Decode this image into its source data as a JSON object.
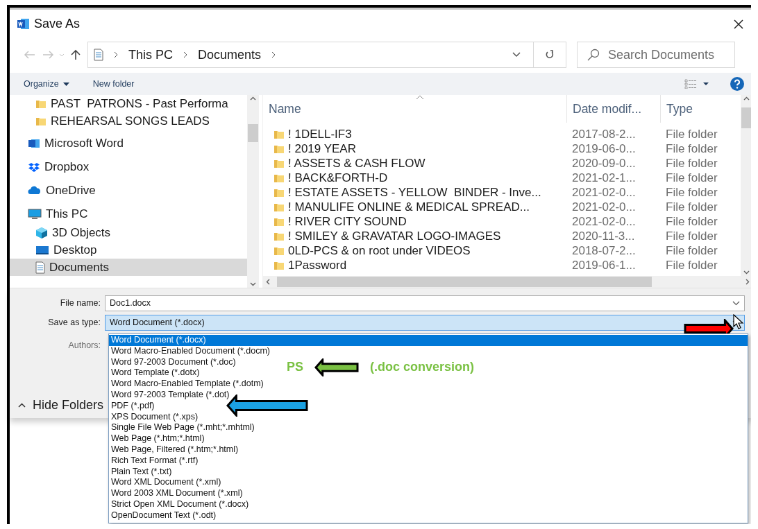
{
  "window": {
    "title": "Save As"
  },
  "address_bar": {
    "crumbs": [
      "This PC",
      "Documents"
    ]
  },
  "search": {
    "placeholder": "Search Documents"
  },
  "toolbar": {
    "buttons": [
      "Organize",
      "New folder"
    ]
  },
  "sidebar": {
    "items": [
      {
        "children": [
          {
            "label": "PAST  PATRONS - Past Performa",
            "kind": "folder",
            "selected": false
          },
          {
            "label": "REHEARSAL SONGS LEADS",
            "kind": "folder",
            "selected": false
          }
        ]
      },
      {
        "label": "Microsoft Word",
        "kind": "word",
        "selected": false
      },
      {
        "label": "Dropbox",
        "kind": "dropbox",
        "selected": false
      },
      {
        "label": "OneDrive",
        "kind": "onedrive",
        "selected": false
      },
      {
        "label": "This PC",
        "kind": "pc",
        "selected": false,
        "children": [
          {
            "label": "3D Objects",
            "kind": "objects",
            "selected": false
          },
          {
            "label": "Desktop",
            "kind": "desktop",
            "selected": false
          },
          {
            "label": "Documents",
            "kind": "documents",
            "selected": true
          }
        ]
      }
    ]
  },
  "file_list": {
    "columns": [
      "Name",
      "Date modif...",
      "Type"
    ],
    "rows": [
      {
        "name": "! 1DELL-IF3",
        "date": "2017-08-2...",
        "type": "File folder"
      },
      {
        "name": "! 2019 YEAR",
        "date": "2019-06-0...",
        "type": "File folder"
      },
      {
        "name": "! ASSETS & CASH FLOW",
        "date": "2020-09-0...",
        "type": "File folder"
      },
      {
        "name": "! BACK&FORTH-D",
        "date": "2021-02-1...",
        "type": "File folder"
      },
      {
        "name": "! ESTATE ASSETS - YELLOW  BINDER - Inve...",
        "date": "2021-02-0...",
        "type": "File folder"
      },
      {
        "name": "! MANULIFE ONLINE & MEDICAL SPREAD...",
        "date": "2021-02-0...",
        "type": "File folder"
      },
      {
        "name": "! RIVER CITY SOUND",
        "date": "2021-02-0...",
        "type": "File folder"
      },
      {
        "name": "! SMILEY & GRAVATAR LOGO-IMAGES",
        "date": "2020-11-3...",
        "type": "File folder"
      },
      {
        "name": "0LD-PCS & on root under VIDEOS",
        "date": "2018-07-2...",
        "type": "File folder"
      },
      {
        "name": "1Password",
        "date": "2019-06-1...",
        "type": "File folder"
      }
    ]
  },
  "form": {
    "file_name": {
      "label": "File name:",
      "value": "Doc1.docx"
    },
    "save_type": {
      "label": "Save as type:",
      "value": "Word Document (*.docx)",
      "annotation": {
        "color": "#ff0000"
      }
    },
    "authors": {
      "label": "Authors:"
    },
    "hide_folders": "Hide Folders"
  },
  "type_options": [
    {
      "label": "Word Document (*.docx)",
      "selected": true
    },
    {
      "label": "Word Macro-Enabled Document (*.docm)",
      "selected": false
    },
    {
      "label": "Word 97-2003 Document (*.doc)",
      "selected": false,
      "annotation": {
        "color": "#7ac143",
        "label": "PS",
        "note": "(.doc conversion)"
      }
    },
    {
      "label": "Word Template (*.dotx)",
      "selected": false
    },
    {
      "label": "Word Macro-Enabled Template (*.dotm)",
      "selected": false
    },
    {
      "label": "Word 97-2003 Template (*.dot)",
      "selected": false
    },
    {
      "label": "PDF (*.pdf)",
      "selected": false,
      "annotation": {
        "color": "#1ba1e2"
      }
    },
    {
      "label": "XPS Document (*.xps)",
      "selected": false
    },
    {
      "label": "Single File Web Page (*.mht;*.mhtml)",
      "selected": false
    },
    {
      "label": "Web Page (*.htm;*.html)",
      "selected": false
    },
    {
      "label": "Web Page, Filtered (*.htm;*.html)",
      "selected": false
    },
    {
      "label": "Rich Text Format (*.rtf)",
      "selected": false
    },
    {
      "label": "Plain Text (*.txt)",
      "selected": false
    },
    {
      "label": "Word XML Document (*.xml)",
      "selected": false
    },
    {
      "label": "Word 2003 XML Document (*.xml)",
      "selected": false
    },
    {
      "label": "Strict Open XML Document (*.docx)",
      "selected": false
    },
    {
      "label": "OpenDocument Text (*.odt)",
      "selected": false
    }
  ]
}
